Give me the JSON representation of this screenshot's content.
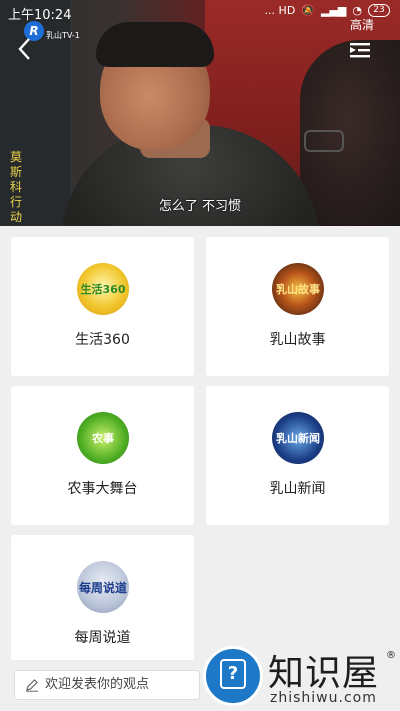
{
  "status_bar": {
    "time": "上午10:24",
    "indicators": "... HD",
    "battery": "23"
  },
  "player": {
    "channel_logo_text": "乳山TV-1",
    "quality_label": "高清",
    "vertical_title": "莫斯科行动",
    "subtitle": "怎么了 不习惯"
  },
  "programs": [
    {
      "label": "生活360",
      "thumb_text": "生活360"
    },
    {
      "label": "乳山故事",
      "thumb_text": "乳山故事"
    },
    {
      "label": "农事大舞台",
      "thumb_text": "农事"
    },
    {
      "label": "乳山新闻",
      "thumb_text": "乳山新闻"
    },
    {
      "label": "每周说道",
      "thumb_text": "每周说道"
    }
  ],
  "comment": {
    "placeholder": "欢迎发表你的观点"
  },
  "watermark": {
    "title": "知识屋",
    "url": "zhishiwu.com",
    "registered": "®"
  }
}
